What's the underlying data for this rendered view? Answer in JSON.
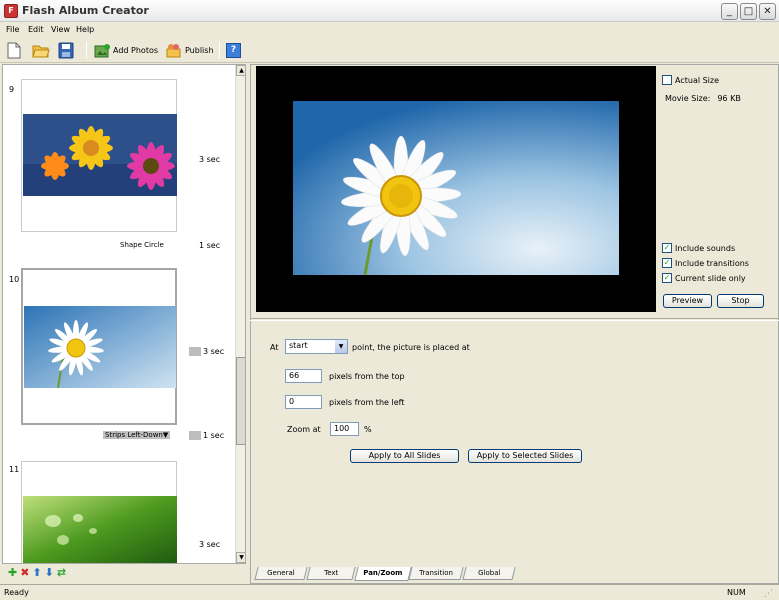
{
  "window": {
    "title": "Flash Album Creator",
    "min": "_",
    "max": "□",
    "close": "✕"
  },
  "menu": [
    "File",
    "Edit",
    "View",
    "Help"
  ],
  "toolbar": {
    "add_photos": "Add Photos",
    "publish": "Publish",
    "help": "?"
  },
  "slides": [
    {
      "number": "9",
      "duration": "3 sec",
      "transition": "Shape Circle",
      "transition_duration": "1 sec"
    },
    {
      "number": "10",
      "duration": "3 sec",
      "transition": "Strips Left-Down",
      "transition_duration": "1 sec"
    },
    {
      "number": "11",
      "duration": "3 sec"
    }
  ],
  "preview": {
    "actual_size_label": "Actual Size",
    "movie_size_label": "Movie Size:",
    "movie_size_value": "96 KB",
    "include_sounds": "Include sounds",
    "include_transitions": "Include transitions",
    "current_slide_only": "Current slide only",
    "preview_button": "Preview",
    "stop_button": "Stop",
    "checkmark": "✓"
  },
  "panzoom": {
    "at_label": "At",
    "point_select": "start",
    "point_suffix": "point, the picture is placed at",
    "top_value": "66",
    "top_label": "pixels from the top",
    "left_value": "0",
    "left_label": "pixels from the left",
    "zoom_label": "Zoom at",
    "zoom_value": "100",
    "zoom_unit": "%",
    "apply_all": "Apply to All Slides",
    "apply_selected": "Apply to Selected Slides"
  },
  "tabs": [
    "General",
    "Text",
    "Pan/Zoom",
    "Transition",
    "Global"
  ],
  "status": {
    "left": "Ready",
    "right": "NUM"
  },
  "colors": {
    "add": "#2aa52a",
    "delete": "#d12b2b",
    "arrows": "#2f74c8"
  }
}
